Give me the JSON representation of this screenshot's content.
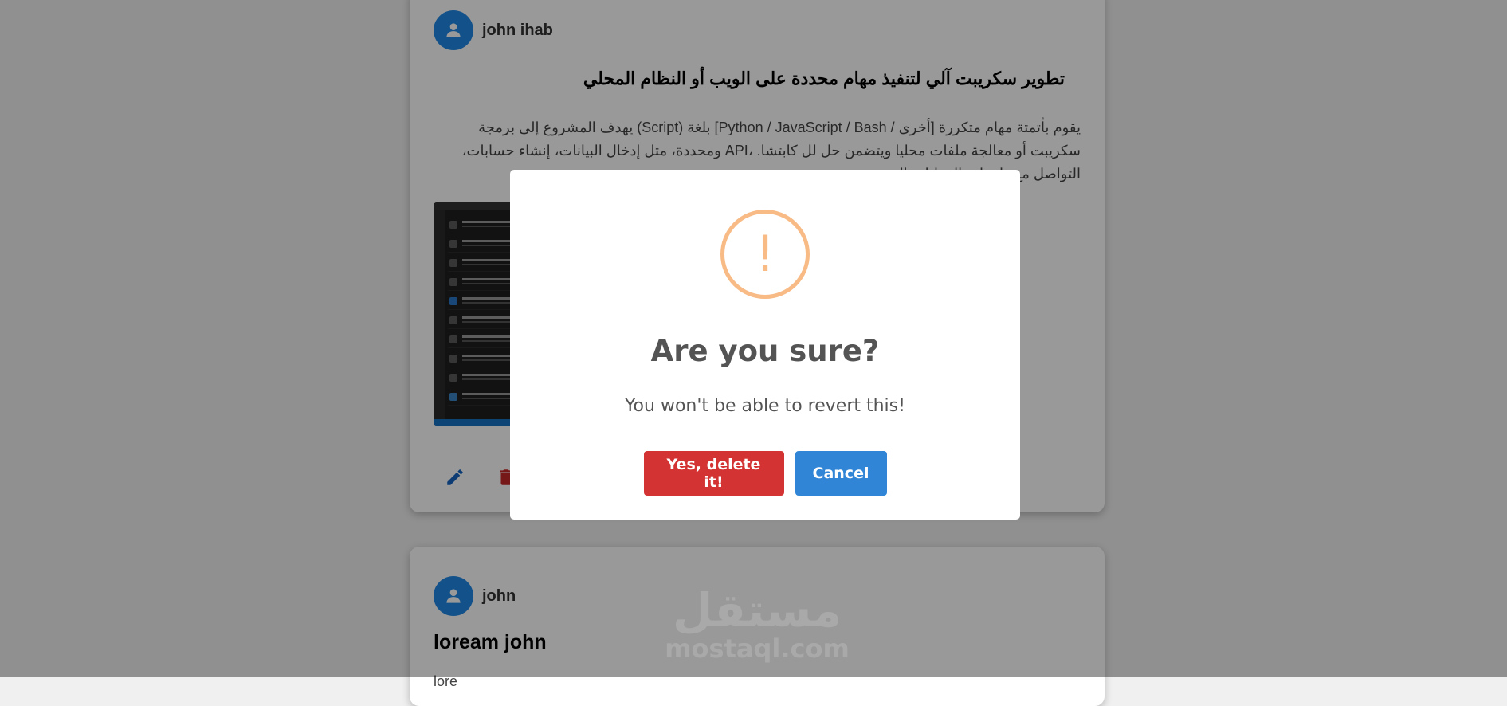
{
  "posts": [
    {
      "author": "john ihab",
      "title": "تطوير سكريبت آلي لتنفيذ مهام محددة على الويب أو النظام المحلي",
      "description": "يقوم بأتمتة مهام متكررة [أخرى / Python / JavaScript / Bash] بلغة (Script) يهدف المشروع إلى برمجة سكريبت أو معالجة ملفات محليا ويتضمن حل لل كابتشا. ،API ومحددة، مثل إدخال البيانات، إنشاء حسابات، التواصل مع واجهات العمليات اليدوية"
    },
    {
      "author": "john",
      "title": "loream john",
      "description": "lore"
    }
  ],
  "icons": {
    "avatar": "person-icon",
    "edit": "pencil-icon",
    "delete": "trash-icon",
    "warning": "exclamation-icon"
  },
  "dialog": {
    "icon_glyph": "!",
    "title": "Are you sure?",
    "text": "You won't be able to revert this!",
    "confirm_label": "Yes, delete it!",
    "cancel_label": "Cancel"
  },
  "watermark": {
    "arabic": "مستقل",
    "latin": "mostaql.com"
  },
  "colors": {
    "avatar": "#1e88e5",
    "edit_icon": "#1565c0",
    "delete_icon": "#c62828",
    "warning": "#f8bb86",
    "confirm": "#d33333",
    "cancel": "#3085d6"
  }
}
